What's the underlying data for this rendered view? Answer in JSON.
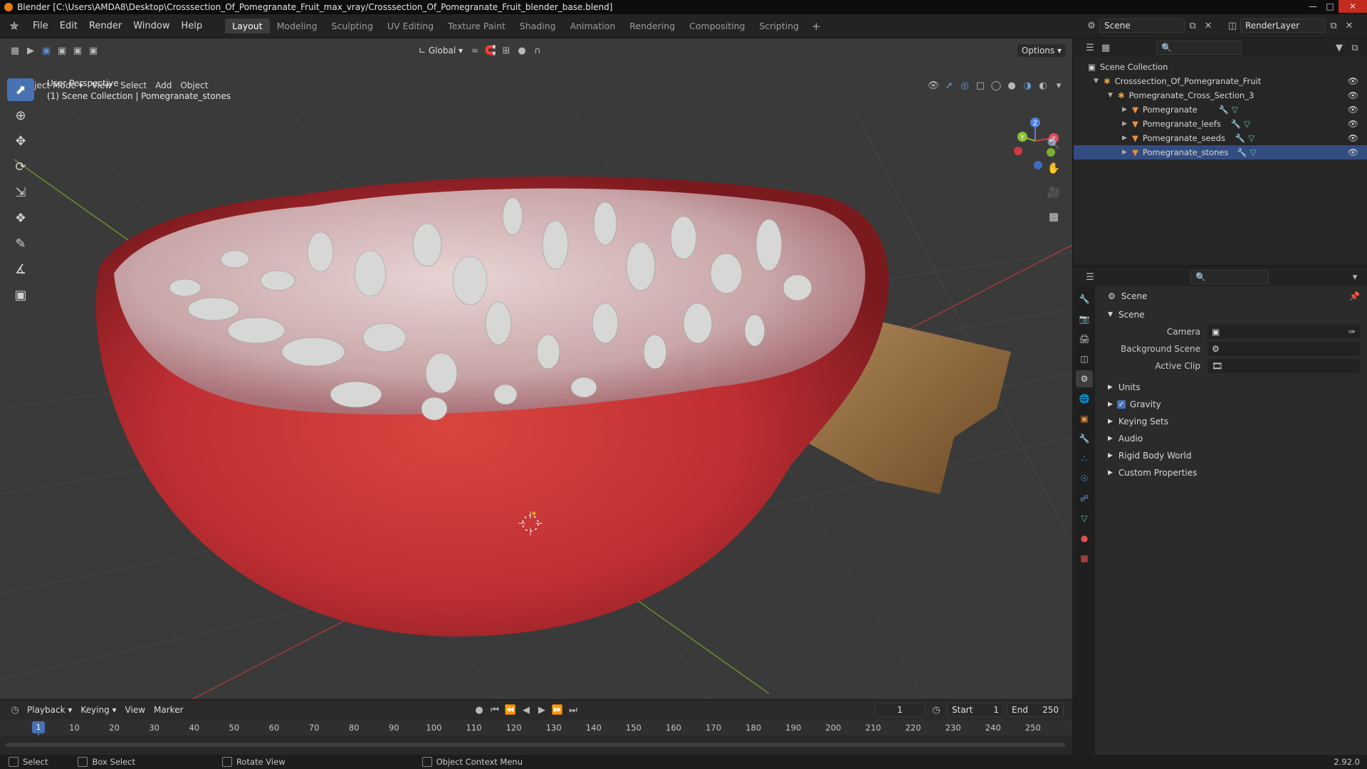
{
  "window": {
    "title": "Blender [C:\\Users\\AMDA8\\Desktop\\Crosssection_Of_Pomegranate_Fruit_max_vray/Crosssection_Of_Pomegranate_Fruit_blender_base.blend]"
  },
  "menu": [
    "File",
    "Edit",
    "Render",
    "Window",
    "Help"
  ],
  "workspaces": [
    "Layout",
    "Modeling",
    "Sculpting",
    "UV Editing",
    "Texture Paint",
    "Shading",
    "Animation",
    "Rendering",
    "Compositing",
    "Scripting"
  ],
  "scene": "Scene",
  "render_layer": "RenderLayer",
  "viewport": {
    "mode": "Object Mode",
    "menus": [
      "View",
      "Select",
      "Add",
      "Object"
    ],
    "transform_orientation": "Global",
    "options": "Options",
    "perspective_label": "User Perspective",
    "collection_label": "(1) Scene Collection | Pomegranate_stones"
  },
  "gizmo": {
    "z": "Z",
    "y": "Y",
    "x": "X"
  },
  "outliner": {
    "root": "Scene Collection",
    "collection": "Crosssection_Of_Pomegranate_Fruit",
    "sub": "Pomegranate_Cross_Section_3",
    "objects": [
      "Pomegranate",
      "Pomegranate_leefs",
      "Pomegranate_seeds",
      "Pomegranate_stones"
    ]
  },
  "properties": {
    "breadcrumb": "Scene",
    "panel": "Scene",
    "camera_label": "Camera",
    "bg_scene_label": "Background Scene",
    "active_clip_label": "Active Clip",
    "sections": [
      "Units",
      "Gravity",
      "Keying Sets",
      "Audio",
      "Rigid Body World",
      "Custom Properties"
    ]
  },
  "timeline": {
    "menus": [
      "Playback",
      "Keying",
      "View",
      "Marker"
    ],
    "current_frame": "1",
    "start_label": "Start",
    "start": "1",
    "end_label": "End",
    "end": "250",
    "ruler": [
      "10",
      "20",
      "30",
      "40",
      "50",
      "60",
      "70",
      "80",
      "90",
      "100",
      "110",
      "120",
      "130",
      "140",
      "150",
      "160",
      "170",
      "180",
      "190",
      "200",
      "210",
      "220",
      "230",
      "240",
      "250"
    ],
    "playhead": "1"
  },
  "status": {
    "select": "Select",
    "box_select": "Box Select",
    "rotate": "Rotate View",
    "context": "Object Context Menu",
    "version": "2.92.0"
  },
  "colors": {
    "accent": "#4772b3",
    "viewport": "#3a3a3a",
    "fruit": "#c8333a"
  }
}
